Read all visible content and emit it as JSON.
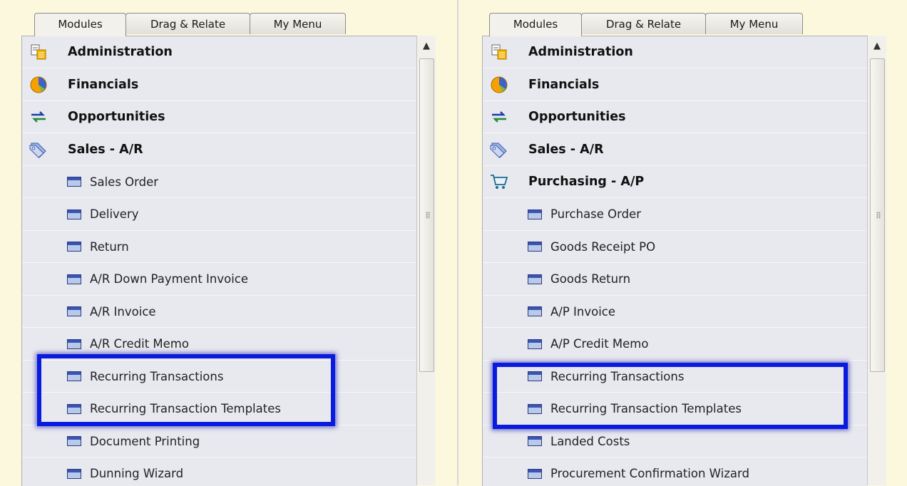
{
  "tabs": [
    "Modules",
    "Drag & Relate",
    "My Menu"
  ],
  "left_panel": {
    "items": [
      {
        "label": "Administration",
        "type": "module",
        "icon": "administration-icon"
      },
      {
        "label": "Financials",
        "type": "module",
        "icon": "financials-pie-icon"
      },
      {
        "label": "Opportunities",
        "type": "module",
        "icon": "opportunities-arrows-icon"
      },
      {
        "label": "Sales - A/R",
        "type": "module",
        "icon": "sales-tag-icon"
      },
      {
        "label": "Sales Order",
        "type": "sub",
        "icon": "window-icon"
      },
      {
        "label": "Delivery",
        "type": "sub",
        "icon": "window-icon"
      },
      {
        "label": "Return",
        "type": "sub",
        "icon": "window-icon"
      },
      {
        "label": "A/R Down Payment Invoice",
        "type": "sub",
        "icon": "window-icon"
      },
      {
        "label": "A/R Invoice",
        "type": "sub",
        "icon": "window-icon"
      },
      {
        "label": "A/R Credit Memo",
        "type": "sub",
        "icon": "window-icon"
      },
      {
        "label": "Recurring Transactions",
        "type": "sub",
        "icon": "window-icon"
      },
      {
        "label": "Recurring Transaction Templates",
        "type": "sub",
        "icon": "window-icon"
      },
      {
        "label": "Document Printing",
        "type": "sub",
        "icon": "window-icon"
      },
      {
        "label": "Dunning Wizard",
        "type": "sub",
        "icon": "window-icon"
      }
    ]
  },
  "right_panel": {
    "items": [
      {
        "label": "Administration",
        "type": "module",
        "icon": "administration-icon"
      },
      {
        "label": "Financials",
        "type": "module",
        "icon": "financials-pie-icon"
      },
      {
        "label": "Opportunities",
        "type": "module",
        "icon": "opportunities-arrows-icon"
      },
      {
        "label": "Sales - A/R",
        "type": "module",
        "icon": "sales-tag-icon"
      },
      {
        "label": "Purchasing - A/P",
        "type": "module",
        "icon": "purchasing-cart-icon"
      },
      {
        "label": "Purchase Order",
        "type": "sub",
        "icon": "window-icon"
      },
      {
        "label": "Goods Receipt PO",
        "type": "sub",
        "icon": "window-icon"
      },
      {
        "label": "Goods Return",
        "type": "sub",
        "icon": "window-icon"
      },
      {
        "label": "A/P Invoice",
        "type": "sub",
        "icon": "window-icon"
      },
      {
        "label": "A/P Credit Memo",
        "type": "sub",
        "icon": "window-icon"
      },
      {
        "label": "Recurring Transactions",
        "type": "sub",
        "icon": "window-icon"
      },
      {
        "label": "Recurring Transaction Templates",
        "type": "sub",
        "icon": "window-icon"
      },
      {
        "label": "Landed Costs",
        "type": "sub",
        "icon": "window-icon"
      },
      {
        "label": "Procurement Confirmation Wizard",
        "type": "sub",
        "icon": "window-icon"
      }
    ]
  },
  "colors": {
    "highlight": "#0a1be0",
    "background": "#fbf8de",
    "menu_bg": "#e8e8ef"
  }
}
